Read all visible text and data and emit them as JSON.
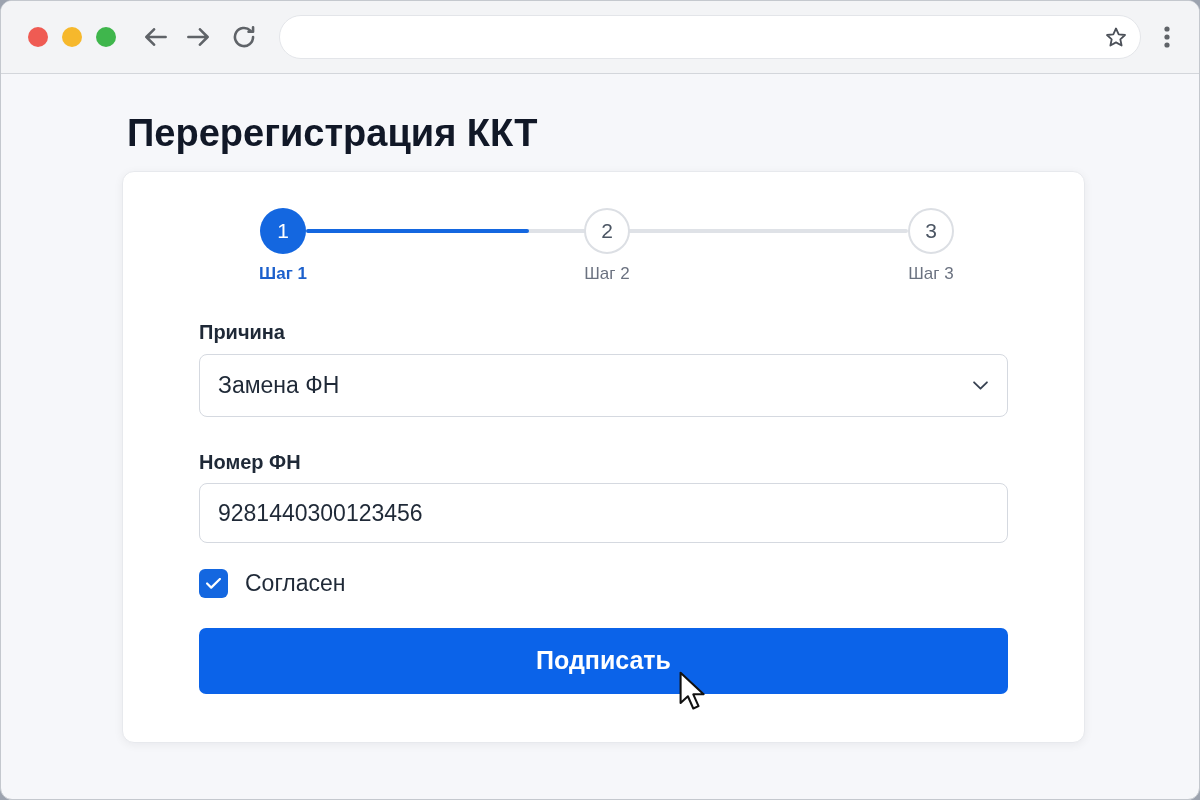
{
  "page": {
    "title": "Перерегистрация ККТ"
  },
  "stepper": {
    "steps": [
      {
        "number": "1",
        "label": "Шаг 1",
        "selected": true
      },
      {
        "number": "2",
        "label": "Шаг 2",
        "selected": false
      },
      {
        "number": "3",
        "label": "Шаг 3",
        "selected": false
      }
    ],
    "progress": {
      "level": 0.37
    }
  },
  "form": {
    "fields": [
      {
        "kind": "select",
        "label": "Причина",
        "value": "Замена ФН"
      },
      {
        "kind": "text",
        "label": "Номер ФН",
        "value": "9281440300123456"
      }
    ],
    "agreement": {
      "label": "Согласен",
      "checked": true
    },
    "submit": {
      "label": "Подписать"
    }
  }
}
